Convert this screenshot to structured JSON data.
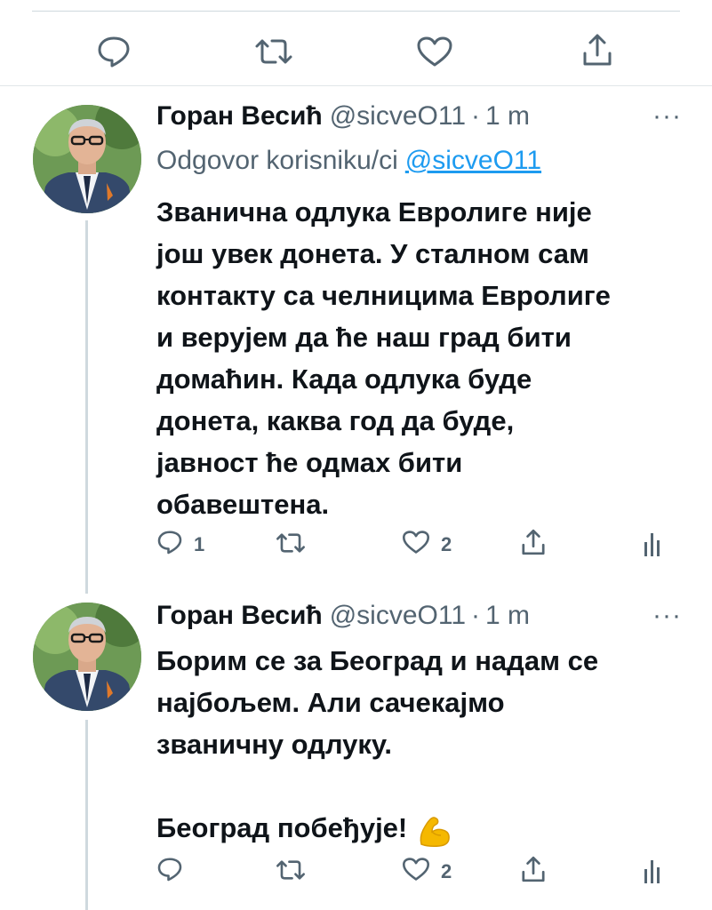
{
  "top_actions": {
    "icons": [
      "reply-icon",
      "retweet-icon",
      "like-icon",
      "share-icon"
    ]
  },
  "tweets": [
    {
      "name": "Горан Весић",
      "handle": "@sicveO11",
      "separator": "·",
      "time": "1 m",
      "more": "···",
      "reply_to_prefix": "Odgovor korisniku/ci",
      "reply_to_mention": "@sicveO11",
      "text": "Званична одлука Евролиге није\nјош увек донета. У сталном сам\nконтакту са челницима Евролиге\nи верујем да ће наш град бити\nдомаћин. Када одлука буде\nдонета, каква год да буде,\nјавност ће одмах бити\nобавештена.",
      "replies": "1",
      "retweets": "",
      "likes": "2"
    },
    {
      "name": "Горан Весић",
      "handle": "@sicveO11",
      "separator": "·",
      "time": "1 m",
      "more": "···",
      "text": "Борим се за Београд и надам се\nнајбољем. Али сачекајмо\nзваничну одлуку.\n\nБеоград побеђује!",
      "emoji": "flexed-biceps",
      "replies": "",
      "retweets": "",
      "likes": "2"
    }
  ],
  "colors": {
    "text": "#0f1419",
    "secondary": "#536471",
    "link": "#1d9bf0",
    "divider": "#cfd9de"
  }
}
